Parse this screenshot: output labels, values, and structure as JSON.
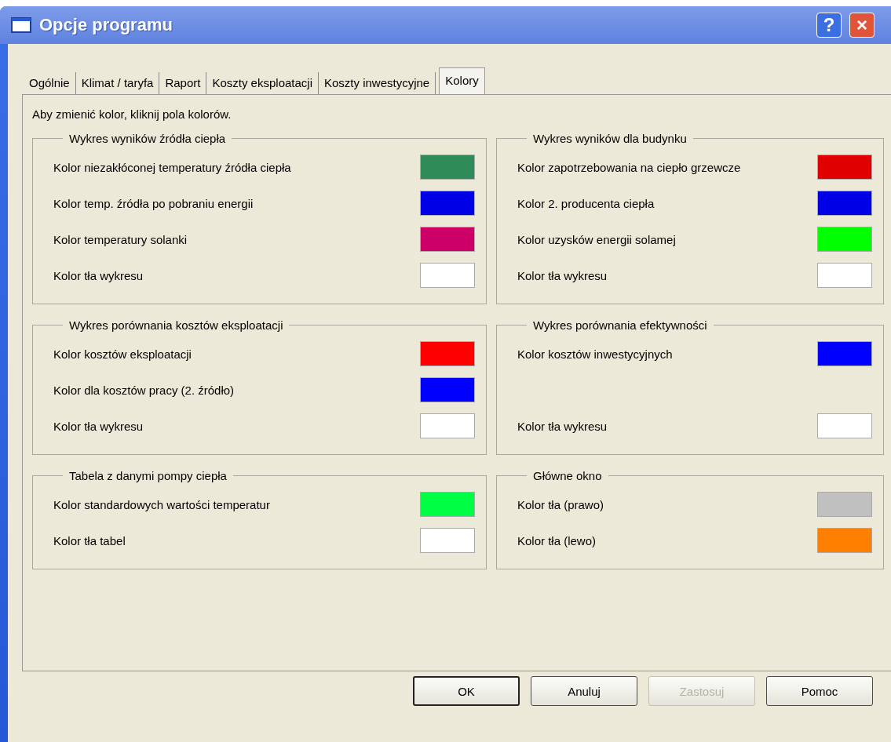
{
  "window": {
    "title": "Opcje programu",
    "help_button": "?",
    "close_button": "×"
  },
  "tabs": [
    {
      "label": "Ogólnie",
      "selected": false
    },
    {
      "label": "Klimat / taryfa",
      "selected": false
    },
    {
      "label": "Raport",
      "selected": false
    },
    {
      "label": "Koszty eksploatacji",
      "selected": false
    },
    {
      "label": "Koszty inwestycyjne",
      "selected": false
    },
    {
      "label": "Kolory",
      "selected": true
    }
  ],
  "hint": "Aby zmienić kolor, kliknij pola kolorów.",
  "groups": [
    {
      "title": "Wykres wyników źródła ciepła",
      "items": [
        {
          "label": "Kolor niezakłóconej temperatury źródła ciepła",
          "color": "#2e8b57"
        },
        {
          "label": "Kolor temp. źródła po pobraniu energii",
          "color": "#0000e6"
        },
        {
          "label": "Kolor temperatury solanki",
          "color": "#cc0066"
        },
        {
          "label": "Kolor tła wykresu",
          "color": "#ffffff"
        }
      ]
    },
    {
      "title": "Wykres wyników dla budynku",
      "items": [
        {
          "label": "Kolor zapotrzebowania na ciepło grzewcze",
          "color": "#e00000"
        },
        {
          "label": "Kolor 2. producenta ciepła",
          "color": "#0000e6"
        },
        {
          "label": "Kolor uzysków energii solamej",
          "color": "#00ff00"
        },
        {
          "label": "Kolor tła wykresu",
          "color": "#ffffff"
        }
      ]
    },
    {
      "title": "Wykres porównania kosztów eksploatacji",
      "items": [
        {
          "label": "Kolor kosztów eksploatacji",
          "color": "#ff0000"
        },
        {
          "label": "Kolor dla kosztów pracy (2. źródło)",
          "color": "#0000ff"
        },
        {
          "label": "Kolor tła wykresu",
          "color": "#ffffff"
        }
      ]
    },
    {
      "title": "Wykres porównania efektywności",
      "items": [
        {
          "label": "Kolor kosztów inwestycyjnych",
          "color": "#0000ff"
        },
        {
          "label": "Kolor tła wykresu",
          "color": "#ffffff"
        }
      ]
    },
    {
      "title": "Tabela z danymi pompy ciepła",
      "items": [
        {
          "label": "Kolor standardowych wartości temperatur",
          "color": "#00ff44"
        },
        {
          "label": "Kolor tła tabel",
          "color": "#ffffff"
        }
      ]
    },
    {
      "title": "Główne okno",
      "items": [
        {
          "label": "Kolor tła (prawo)",
          "color": "#c0c0c0"
        },
        {
          "label": "Kolor tła (lewo)",
          "color": "#ff8000"
        }
      ]
    }
  ],
  "buttons": [
    {
      "label": "OK",
      "kind": "default",
      "disabled": false
    },
    {
      "label": "Anuluj",
      "kind": "normal",
      "disabled": false
    },
    {
      "label": "Zastosuj",
      "kind": "normal",
      "disabled": true
    },
    {
      "label": "Pomoc",
      "kind": "normal",
      "disabled": false
    }
  ]
}
